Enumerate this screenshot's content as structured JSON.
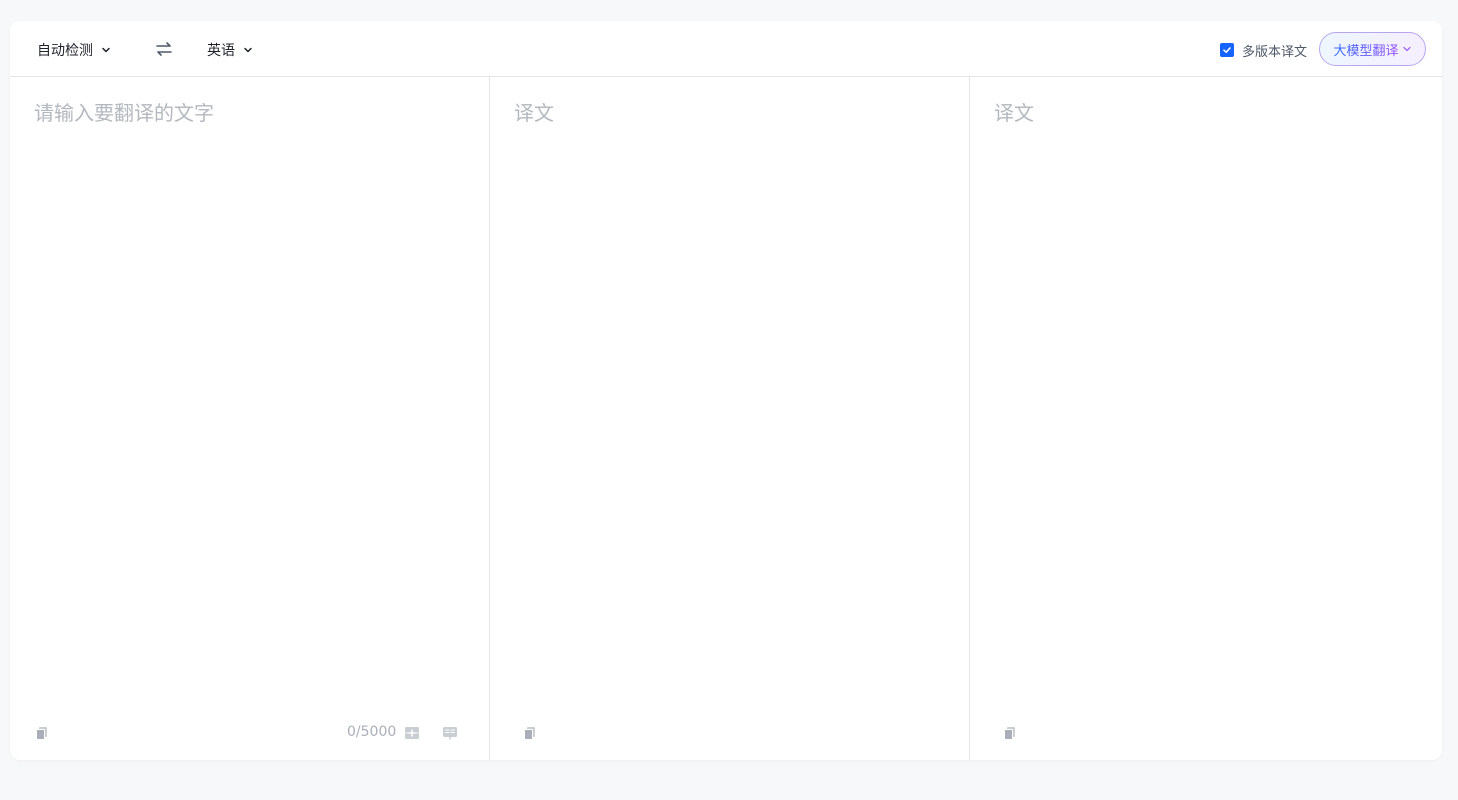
{
  "toolbar": {
    "source_language": "自动检测",
    "target_language": "英语",
    "multi_version_label": "多版本译文",
    "multi_version_checked": true,
    "llm_button_label": "大模型翻译",
    "icons": {
      "swap": "swap-icon",
      "chevron": "chevron-down-icon"
    }
  },
  "source_pane": {
    "placeholder": "请输入要翻译的文字",
    "value": "",
    "char_count": "0/5000",
    "icons": [
      "copy-icon",
      "add-term-icon",
      "reading-icon"
    ]
  },
  "translation_panes": [
    {
      "placeholder": "译文",
      "icons": [
        "copy-icon"
      ]
    },
    {
      "placeholder": "译文",
      "icons": [
        "copy-icon"
      ]
    }
  ],
  "colors": {
    "accent": "#1664ff",
    "placeholder": "#b4b8bf",
    "border": "#e5e6eb",
    "llm_gradient_start": "#2f6bff",
    "llm_gradient_end": "#9a4dff"
  }
}
